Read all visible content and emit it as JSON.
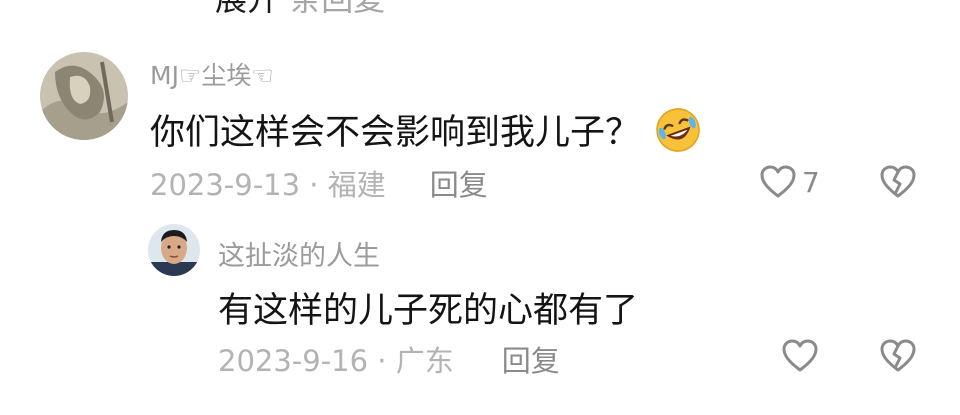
{
  "top_cut": {
    "text": "展开",
    "meta": "条回复"
  },
  "comment": {
    "username": "MJ☞尘埃☜",
    "text": "你们这样会不会影响到我儿子？",
    "emoji": "rofl-emoji",
    "date": "2023-9-13",
    "location": "福建",
    "date_loc": "2023-9-13 · 福建",
    "reply_label": "回复",
    "like_count": "7"
  },
  "reply": {
    "username": "这扯淡的人生",
    "text": "有这样的儿子死的心都有了",
    "date": "2023-9-16",
    "location": "广东",
    "date_loc": "2023-9-16 · 广东",
    "reply_label": "回复"
  },
  "icons": {
    "like": "heart-outline-icon",
    "dislike": "broken-heart-icon"
  },
  "colors": {
    "text_primary": "#141414",
    "text_secondary": "#9b9b9b",
    "meta": "#b3b3b3",
    "icon": "#8a8a8a"
  }
}
